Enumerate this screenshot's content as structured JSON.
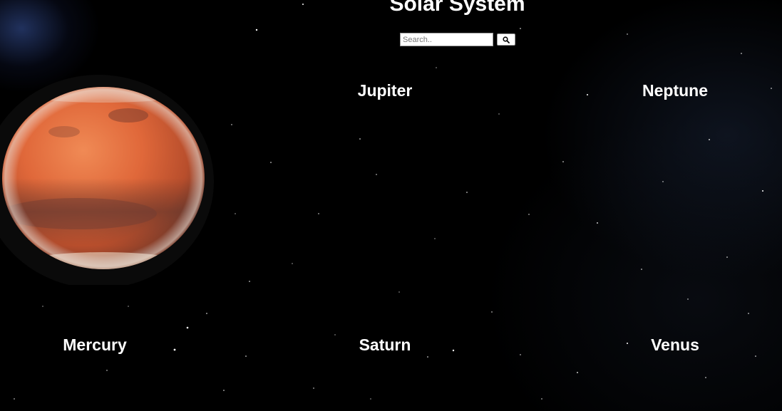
{
  "page": {
    "title": "Solar System"
  },
  "search": {
    "placeholder": "Search..",
    "value": "",
    "button_icon": "search-icon"
  },
  "planets": [
    {
      "name": "Jupiter"
    },
    {
      "name": "Neptune"
    },
    {
      "name": "Mercury"
    },
    {
      "name": "Saturn"
    },
    {
      "name": "Venus"
    }
  ],
  "featured_image": {
    "subject": "Mars",
    "icon": "mars-planet-image"
  },
  "colors": {
    "background": "#000000",
    "text": "#ffffff",
    "mars": "#e0683a"
  }
}
